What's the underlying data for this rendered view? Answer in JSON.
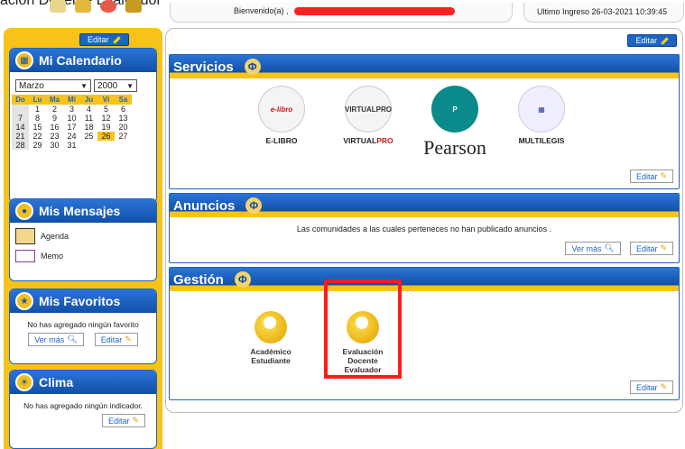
{
  "top": {
    "cut_title": "ación Docente Evaluador\"",
    "welcome": "Bienvenido(a) ,",
    "last_login": "Ultimo Ingreso 26-03-2021 10:39:45",
    "edit_label": "Editar"
  },
  "calendar": {
    "title": "Mi Calendario",
    "month": "Marzo",
    "year": "2000",
    "weekdays": [
      "Do",
      "Lu",
      "Ma",
      "Mi",
      "Ju",
      "Vi",
      "Sa"
    ],
    "weeks": [
      [
        "",
        "",
        "",
        "1",
        "2",
        "3",
        "4"
      ],
      [
        "5",
        "6",
        "7",
        "8",
        "9",
        "10",
        "11"
      ],
      [
        "12",
        "13",
        "14",
        "15",
        "16",
        "17",
        "18"
      ],
      [
        "19",
        "20",
        "21",
        "22",
        "23",
        "24",
        "25"
      ],
      [
        "26",
        "27",
        "28",
        "29",
        "30",
        "31",
        ""
      ]
    ],
    "rows": [
      [
        "",
        "1",
        "2",
        "3",
        "4",
        "5",
        "6"
      ],
      [
        "7",
        "8",
        "9",
        "10",
        "11",
        "12",
        "13"
      ],
      [
        "14",
        "15",
        "16",
        "17",
        "18",
        "19",
        "20"
      ],
      [
        "21",
        "22",
        "23",
        "24",
        "25",
        "26",
        "27"
      ],
      [
        "28",
        "29",
        "30",
        "31",
        "",
        "",
        ""
      ]
    ],
    "today": "26"
  },
  "messages": {
    "title": "Mis Mensajes",
    "agenda": "Agenda",
    "memo": "Memo"
  },
  "favorites": {
    "title": "Mis Favoritos",
    "empty": "No has agregado ningún favorito",
    "more": "Ver más",
    "edit": "Editar"
  },
  "clima": {
    "title": "Clima",
    "empty": "No has agregado ningún indicador.",
    "edit": "Editar"
  },
  "services": {
    "title": "Servicios",
    "items": [
      {
        "name": "E-LIBRO",
        "logo": "e-libro"
      },
      {
        "name_a": "VIRTUAL",
        "name_b": "PRO",
        "logo": "VIRTUALPRO"
      },
      {
        "name": "Pearson",
        "logo": "P"
      },
      {
        "name": "MULTILEGIS",
        "logo": "▦"
      }
    ],
    "edit": "Editar"
  },
  "announcements": {
    "title": "Anuncios",
    "text": "Las comunidades a las cuales perteneces no han publicado anuncios .",
    "more": "Ver más",
    "edit": "Editar"
  },
  "management": {
    "title": "Gestión",
    "items": [
      {
        "line1": "Académico",
        "line2": "Estudiante"
      },
      {
        "line1": "Evaluación",
        "line2": "Docente",
        "line3": "Evaluador"
      }
    ],
    "edit": "Editar"
  },
  "colors": {
    "brand_blue": "#1d64c4",
    "brand_yellow": "#f8c318",
    "highlight_red": "#ff1a1a"
  }
}
